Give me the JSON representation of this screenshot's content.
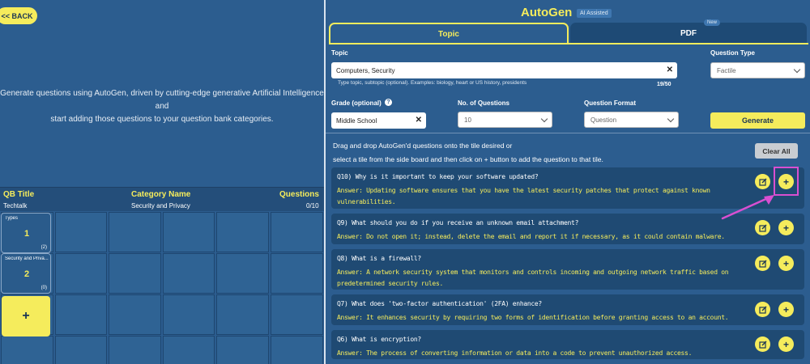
{
  "left": {
    "back_label": "<< BACK",
    "intro_line1": "Generate questions using AutoGen, driven by cutting-edge generative Artificial Intelligence and",
    "intro_line2": "start adding those questions to your question bank categories.",
    "table_headers": {
      "qb_title": "QB Title",
      "category_name": "Category Name",
      "questions": "Questions"
    },
    "row": {
      "qb_title": "Techtalk",
      "category_name": "Security and Privacy",
      "questions": "0/10"
    },
    "tiles": [
      {
        "name": "Types",
        "number": "1",
        "count": "(2)"
      },
      {
        "name": "Security and Priva...",
        "number": "2",
        "count": "(0)"
      }
    ],
    "add_tile_label": "+"
  },
  "header": {
    "title": "AutoGen",
    "ai_badge": "AI Assisted",
    "tabs": [
      {
        "label": "Topic",
        "active": true
      },
      {
        "label": "PDF",
        "active": false
      }
    ],
    "new_badge": "New"
  },
  "form": {
    "topic_label": "Topic",
    "topic_value": "Computers, Security",
    "topic_hint": "Type topic, subtopic (optional). Examples: biology, heart or US history, presidents",
    "topic_counter": "19/50",
    "question_type_label": "Question Type",
    "question_type_value": "Factile",
    "grade_label": "Grade (optional)",
    "grade_value": "Middle School",
    "num_questions_label": "No. of Questions",
    "num_questions_value": "10",
    "format_label": "Question Format",
    "format_value": "Question",
    "generate_label": "Generate"
  },
  "results": {
    "drag_hint_line1": "Drag and drop AutoGen'd questions onto the tile desired or",
    "drag_hint_line2": "select a tile from the side board and then click on + button to add the question to that tile.",
    "clear_label": "Clear All",
    "questions": [
      {
        "q": "Q10) Why is it important to keep your software updated?",
        "a": "Answer: Updating software ensures that you have the latest security patches that protect against known vulnerabilities."
      },
      {
        "q": "Q9) What should you do if you receive an unknown email attachment?",
        "a": "Answer: Do not open it; instead, delete the email and report it if necessary, as it could contain malware."
      },
      {
        "q": "Q8) What is a firewall?",
        "a": "Answer: A network security system that monitors and controls incoming and outgoing network traffic based on predetermined security rules."
      },
      {
        "q": "Q7) What does 'two-factor authentication' (2FA) enhance?",
        "a": "Answer: It enhances security by requiring two forms of identification before granting access to an account."
      },
      {
        "q": "Q6) What is encryption?",
        "a": "Answer: The process of converting information or data into a code to prevent unauthorized access."
      }
    ],
    "add_label": "+"
  },
  "colors": {
    "accent": "#f5ec5c",
    "background": "#2c5d8f",
    "card": "#1f4a73",
    "annotation": "#d94fd1"
  }
}
